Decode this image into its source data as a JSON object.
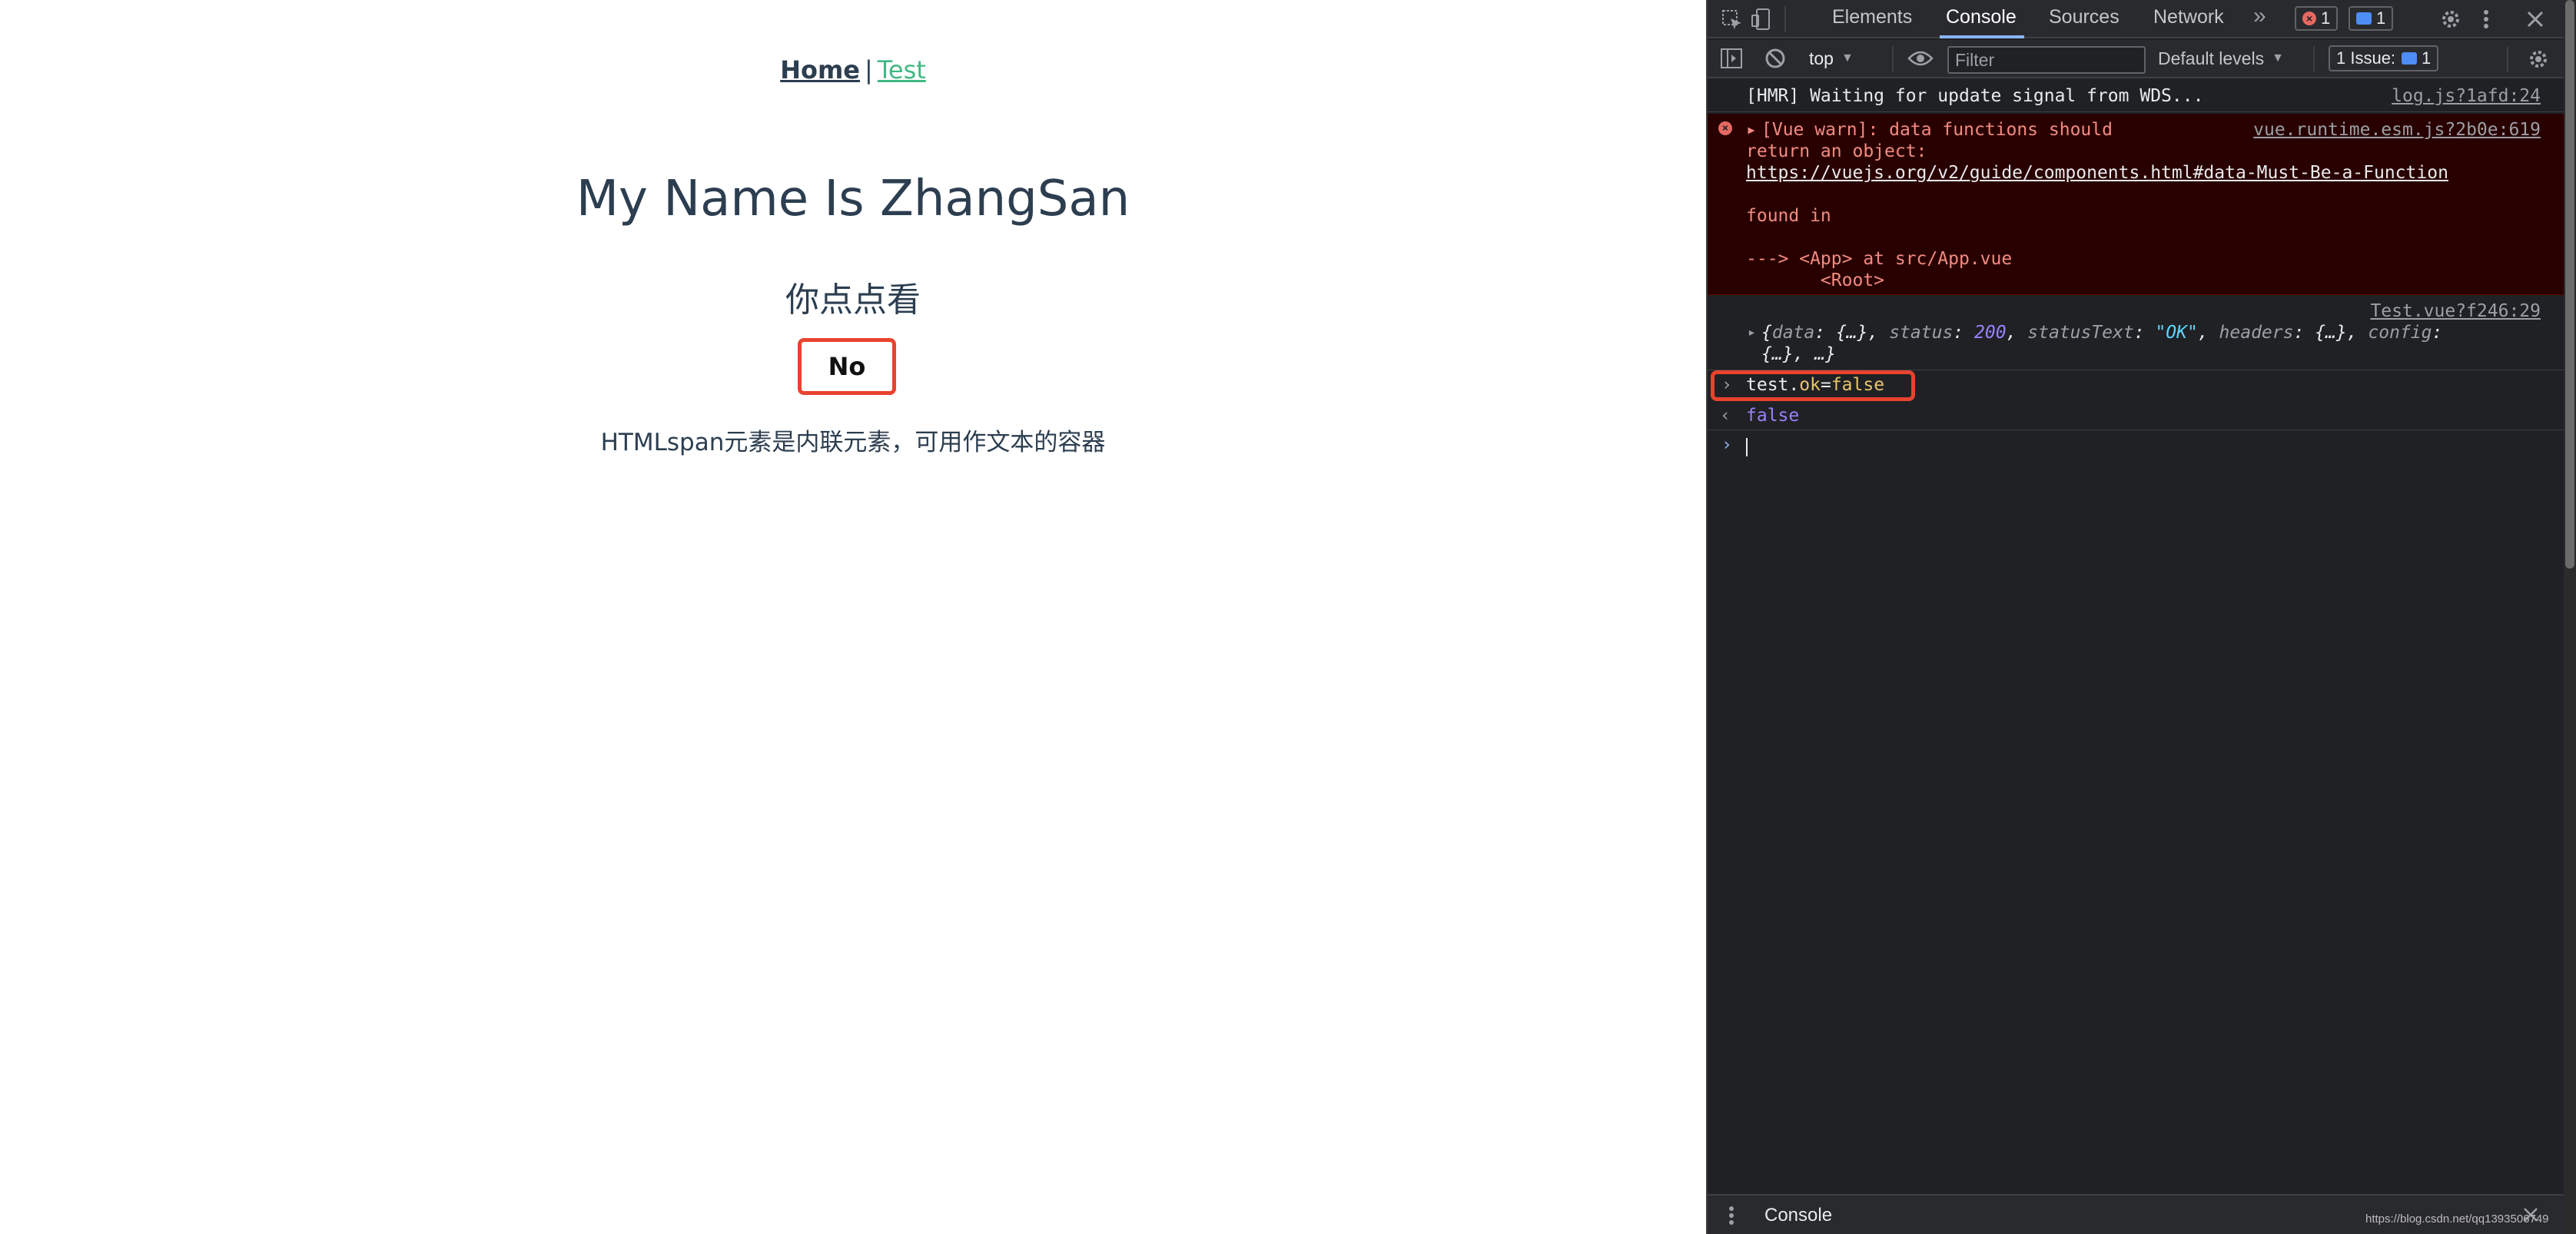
{
  "app": {
    "nav": {
      "home": "Home",
      "separator": "|",
      "test": "Test"
    },
    "heading": "My Name Is ZhangSan",
    "subheading": "你点点看",
    "button_label": "No",
    "span_text": "HTMLspan元素是内联元素，可用作文本的容器",
    "colors": {
      "text": "#2c3e50",
      "active_link": "#42b983",
      "highlight": "#e8432e"
    }
  },
  "devtools": {
    "tabs": [
      {
        "label": "Elements"
      },
      {
        "label": "Console"
      },
      {
        "label": "Sources"
      },
      {
        "label": "Network"
      }
    ],
    "more_tabs_glyph": "»",
    "error_count": "1",
    "message_count": "1",
    "toolbar": {
      "context": "top",
      "filter_placeholder": "Filter",
      "levels": "Default levels",
      "issues_label": "1 Issue:",
      "issues_count": "1"
    },
    "console": {
      "hmr": {
        "text": "[HMR] Waiting for update signal from WDS...",
        "source": "log.js?1afd:24"
      },
      "warn": {
        "line1": "[Vue warn]: data functions should",
        "line2": "return an object:",
        "link": "https://vuejs.org/v2/guide/components.html#data-Must-Be-a-Function",
        "found": "found in",
        "trace1": "---> <App> at src/App.vue",
        "trace2": "       <Root>",
        "source": "vue.runtime.esm.js?2b0e:619"
      },
      "log": {
        "source": "Test.vue?f246:29",
        "open": "{",
        "data_key": "data",
        "data_val": "{…}",
        "status_key": "status",
        "status_val": "200",
        "statusText_key": "statusText",
        "statusText_val": "\"OK\"",
        "headers_key": "headers",
        "headers_val": "{…}",
        "config_key": "config",
        "line2": "{…}, …}"
      },
      "input": {
        "obj": "test",
        "dot": ".",
        "prop": "ok",
        "assign": "=",
        "value": "false"
      },
      "result": "false"
    },
    "drawer_tab": "Console"
  },
  "watermark": "https://blog.csdn.net/qq1393506749"
}
